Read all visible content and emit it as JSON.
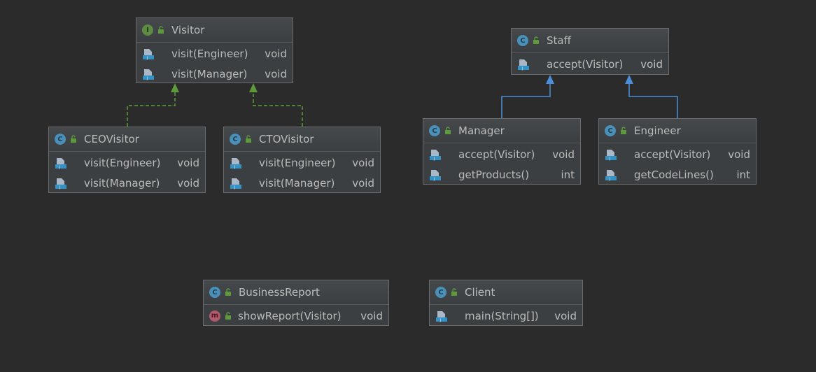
{
  "colors": {
    "background": "#2b2b2b",
    "node_fill": "#3c3f41",
    "implements_arrow": "#5e9a3c",
    "extends_arrow": "#4a8fd8"
  },
  "nodes": {
    "visitor": {
      "kind": "I",
      "title": "Visitor",
      "members": [
        {
          "name": "visit(Engineer)",
          "type": "void"
        },
        {
          "name": "visit(Manager)",
          "type": "void"
        }
      ]
    },
    "staff": {
      "kind": "C",
      "title": "Staff",
      "members": [
        {
          "name": "accept(Visitor)",
          "type": "void"
        }
      ]
    },
    "ceo_visitor": {
      "kind": "C",
      "title": "CEOVisitor",
      "members": [
        {
          "name": "visit(Engineer)",
          "type": "void"
        },
        {
          "name": "visit(Manager)",
          "type": "void"
        }
      ]
    },
    "cto_visitor": {
      "kind": "C",
      "title": "CTOVisitor",
      "members": [
        {
          "name": "visit(Engineer)",
          "type": "void"
        },
        {
          "name": "visit(Manager)",
          "type": "void"
        }
      ]
    },
    "manager": {
      "kind": "C",
      "title": "Manager",
      "members": [
        {
          "name": "accept(Visitor)",
          "type": "void"
        },
        {
          "name": "getProducts()",
          "type": "int"
        }
      ]
    },
    "engineer": {
      "kind": "C",
      "title": "Engineer",
      "members": [
        {
          "name": "accept(Visitor)",
          "type": "void"
        },
        {
          "name": "getCodeLines()",
          "type": "int"
        }
      ]
    },
    "business_report": {
      "kind": "C",
      "title": "BusinessReport",
      "members": [
        {
          "name": "showReport(Visitor)",
          "type": "void",
          "icon": "m"
        }
      ]
    },
    "client": {
      "kind": "C",
      "title": "Client",
      "members": [
        {
          "name": "main(String[])",
          "type": "void"
        }
      ]
    }
  },
  "edges": [
    {
      "from": "CEOVisitor",
      "to": "Visitor",
      "relation": "implements"
    },
    {
      "from": "CTOVisitor",
      "to": "Visitor",
      "relation": "implements"
    },
    {
      "from": "Manager",
      "to": "Staff",
      "relation": "extends"
    },
    {
      "from": "Engineer",
      "to": "Staff",
      "relation": "extends"
    }
  ]
}
